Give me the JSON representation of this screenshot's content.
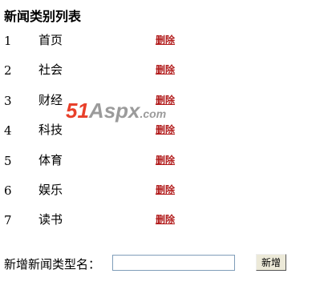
{
  "page": {
    "title": "新闻类别列表"
  },
  "categories": [
    {
      "num": "1",
      "name": "首页",
      "delete_label": "删除"
    },
    {
      "num": "2",
      "name": "社会",
      "delete_label": "删除"
    },
    {
      "num": "3",
      "name": "财经",
      "delete_label": "删除"
    },
    {
      "num": "4",
      "name": "科技",
      "delete_label": "删除"
    },
    {
      "num": "5",
      "name": "体育",
      "delete_label": "删除"
    },
    {
      "num": "6",
      "name": "娱乐",
      "delete_label": "删除"
    },
    {
      "num": "7",
      "name": "读书",
      "delete_label": "删除"
    }
  ],
  "add_form": {
    "label": "新增新闻类型名：",
    "input_value": "",
    "button_label": "新增"
  },
  "watermark": {
    "num": "51",
    "name": "Aspx",
    "tld": ".com"
  },
  "colors": {
    "delete_link": "#b21c1c",
    "watermark_accent": "#e8402a",
    "watermark_gray": "#9b9b9b"
  }
}
